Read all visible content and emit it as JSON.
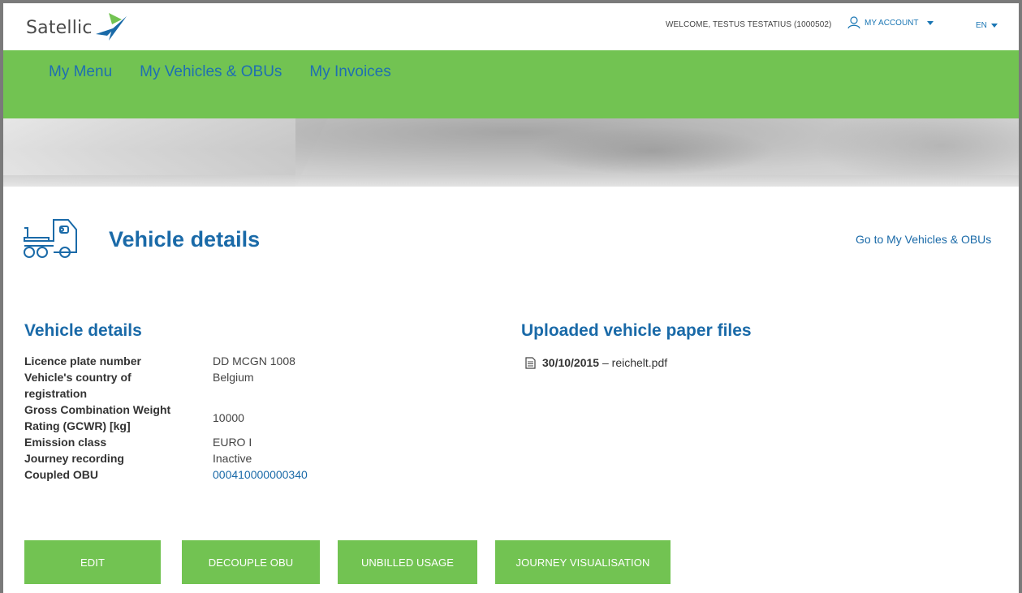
{
  "brand": {
    "logo_text": "Satellic",
    "primary_green": "#72c352",
    "primary_blue": "#1a6aa8"
  },
  "header": {
    "welcome": "WELCOME, TESTUS TESTATIUS (1000502)",
    "account_label": "MY ACCOUNT",
    "language": "EN"
  },
  "nav": {
    "items": [
      {
        "label": "My Menu"
      },
      {
        "label": "My Vehicles & OBUs"
      },
      {
        "label": "My Invoices"
      }
    ]
  },
  "page": {
    "title": "Vehicle details",
    "back_link": "Go to My Vehicles & OBUs"
  },
  "vehicle_details": {
    "title": "Vehicle details",
    "rows": [
      {
        "label": "Licence plate number",
        "value": "DD MCGN 1008"
      },
      {
        "label": "Vehicle's country of registration",
        "value": "Belgium"
      },
      {
        "label": "Gross Combination Weight Rating (GCWR) [kg]",
        "value": "10000"
      },
      {
        "label": "Emission class",
        "value": "EURO I"
      },
      {
        "label": "Journey recording",
        "value": "Inactive"
      },
      {
        "label": "Coupled OBU",
        "value": "000410000000340"
      }
    ]
  },
  "uploads": {
    "title": "Uploaded vehicle paper files",
    "files": [
      {
        "date": "30/10/2015",
        "separator": " – ",
        "name": "reichelt.pdf"
      }
    ]
  },
  "actions": {
    "edit": "EDIT",
    "decouple": "DECOUPLE OBU",
    "unbilled": "UNBILLED USAGE",
    "journey": "JOURNEY VISUALISATION"
  }
}
